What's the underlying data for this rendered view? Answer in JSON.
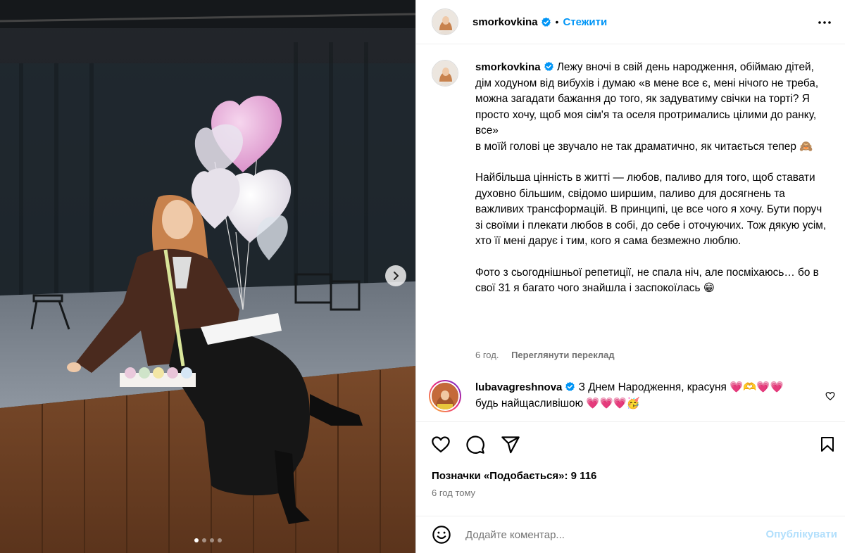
{
  "post": {
    "username": "smorkovkina",
    "follow_label": "Стежити",
    "separator": "•",
    "caption_lines": [
      "Лежу вночі в свій день народження, обіймаю дітей, дім ходуном від вибухів і думаю «в мене все є, мені нічого не треба, можна загадати бажання до того, як задуватиму свічки на торті? Я просто хочу, щоб моя сім'я та оселя протримались цілими до ранку, все»",
      "в моїй голові це звучало не так драматично, як читається тепер 🙈"
    ],
    "caption_para2": "Найбільша цінність в житті — любов, паливо для того, щоб ставати духовно більшим, свідомо ширшим, паливо для досягнень та важливих трансформацій. В принципі, це все чого я хочу. Бути поруч зі своїми і плекати любов в собі, до себе і оточуючих. Тож дякую усім, хто її мені дарує і тим, кого я сама безмежно люблю.",
    "caption_para3": "Фото з сьогоднішньої репетиції, не спала ніч, але посміхаюсь… бо в свої 31 я багато чого знайшла і заспокоїлась 😁",
    "caption_time": "6 год.",
    "translate_label": "Переглянути переклад",
    "likes_text": "Позначки «Подобається»: 9 116",
    "time_ago": "6 год тому",
    "carousel_total": 4,
    "carousel_active": 1
  },
  "comment": {
    "username": "lubavagreshnova",
    "text": "З Днем Народження, красуня 💗🫶💗💗 будь найщасливішою 💗💗💗🥳"
  },
  "comment_box": {
    "placeholder": "Додайте коментар...",
    "publish_label": "Опублікувати"
  },
  "colors": {
    "accent": "#0095f6",
    "publish_disabled": "#b2dffc",
    "muted": "#737373"
  },
  "icons": [
    "verified-icon",
    "more-icon",
    "heart-icon",
    "comment-icon",
    "share-icon",
    "bookmark-icon",
    "emoji-icon",
    "chevron-right-icon"
  ]
}
